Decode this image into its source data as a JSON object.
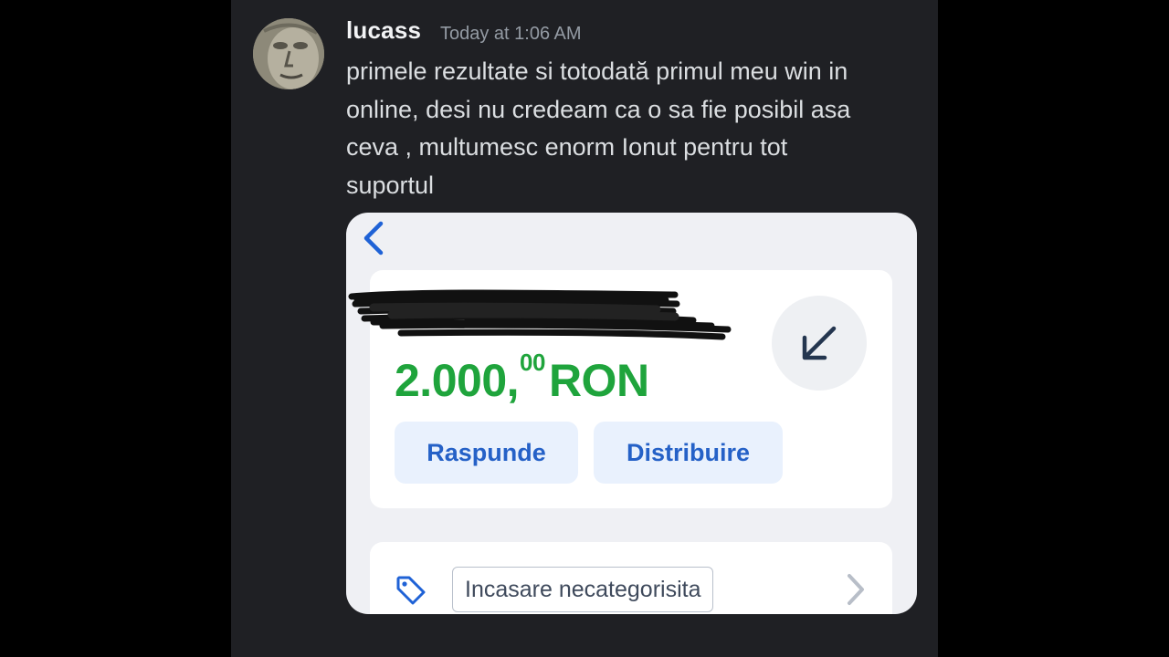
{
  "message": {
    "author": "lucass",
    "timestamp": "Today at 1:06 AM",
    "text_lines": [
      "primele rezultate si totodată primul meu win in",
      "online, desi nu credeam ca o sa fie posibil asa",
      "ceva , multumesc enorm Ionut pentru tot",
      "suportul"
    ]
  },
  "attachment": {
    "amount_main": "2.000,",
    "amount_decimals": "00",
    "amount_currency": "RON",
    "reply_label": "Raspunde",
    "share_label": "Distribuire",
    "category_label": "Incasare necategorisita",
    "icons": {
      "back": "chevron-left-icon",
      "incoming": "arrow-down-left-icon",
      "tag": "tag-icon",
      "forward": "chevron-right-icon"
    }
  },
  "colors": {
    "background": "#1f2024",
    "amount": "#1fa43c",
    "accent": "#2561c7"
  }
}
